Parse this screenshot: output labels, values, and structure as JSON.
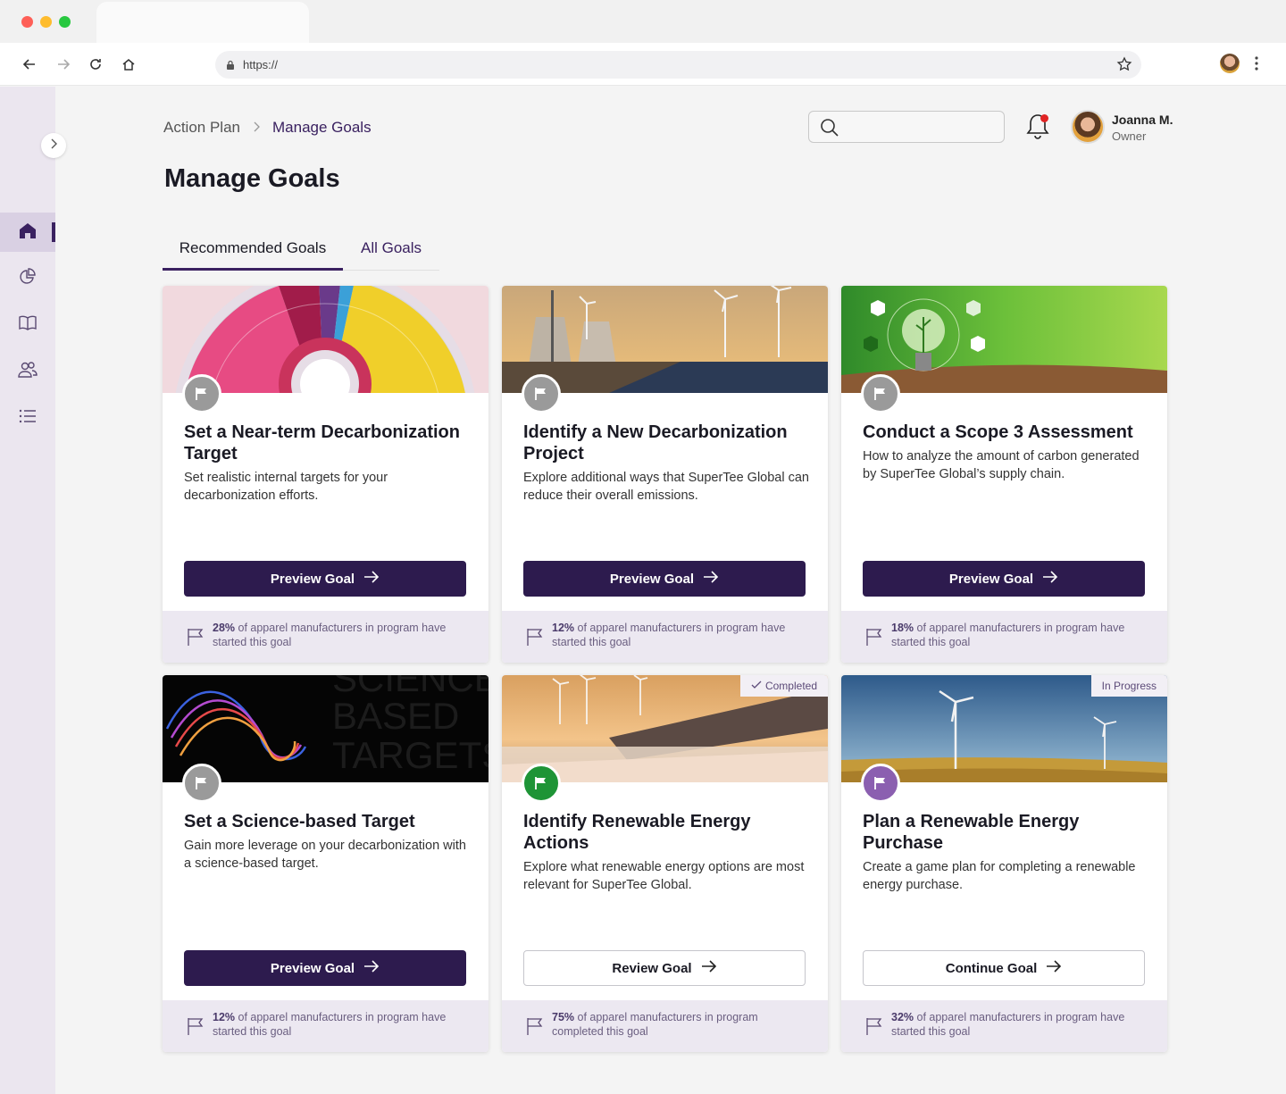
{
  "browser": {
    "url": "https://"
  },
  "breadcrumb": {
    "items": [
      "Action Plan",
      "Manage Goals"
    ]
  },
  "page": {
    "title": "Manage Goals"
  },
  "user": {
    "name": "Joanna M.",
    "role": "Owner"
  },
  "tabs": [
    "Recommended Goals",
    "All Goals"
  ],
  "colors": {
    "brand": "#2d1b4e",
    "flag_gray": "#9a9a9a",
    "flag_green": "#1e9436",
    "flag_purple": "#8b5fb0"
  },
  "cards": [
    {
      "title": "Set a Near-term Decarbonization Target",
      "desc": "Set realistic internal targets for your decarbonization efforts.",
      "button": "Preview Goal",
      "stat_pct": "28%",
      "stat_text": " of apparel manufacturers in program have started this goal",
      "status": "",
      "flag": "gray"
    },
    {
      "title": "Identify a New Decarbonization Project",
      "desc": "Explore additional ways that SuperTee Global can reduce their overall emissions.",
      "button": "Preview Goal",
      "stat_pct": "12%",
      "stat_text": " of apparel manufacturers in program have started this goal",
      "status": "",
      "flag": "gray"
    },
    {
      "title": "Conduct a Scope 3 Assessment",
      "desc": "How to analyze the amount of carbon generated by SuperTee Global’s supply chain.",
      "button": "Preview Goal",
      "stat_pct": "18%",
      "stat_text": " of apparel manufacturers in program have started this goal",
      "status": "",
      "flag": "gray"
    },
    {
      "title": "Set a Science-based Target",
      "desc": "Gain more leverage on your decarbonization with a science-based target.",
      "button": "Preview Goal",
      "stat_pct": "12%",
      "stat_text": " of apparel manufacturers in program have started this goal",
      "status": "",
      "flag": "gray",
      "image_text": [
        "SCIENCE",
        "BASED",
        "TARGETS"
      ]
    },
    {
      "title": "Identify Renewable Energy Actions",
      "desc": "Explore what renewable energy options are most relevant for SuperTee Global.",
      "button": "Review Goal",
      "stat_pct": "75%",
      "stat_text": " of apparel manufacturers in program completed this goal",
      "status": "Completed",
      "flag": "green"
    },
    {
      "title": "Plan a Renewable Energy Purchase",
      "desc": "Create a game plan for completing a renewable energy purchase.",
      "button": "Continue Goal",
      "stat_pct": "32%",
      "stat_text": " of apparel manufacturers in program have started this goal",
      "status": "In Progress",
      "flag": "purple"
    }
  ]
}
